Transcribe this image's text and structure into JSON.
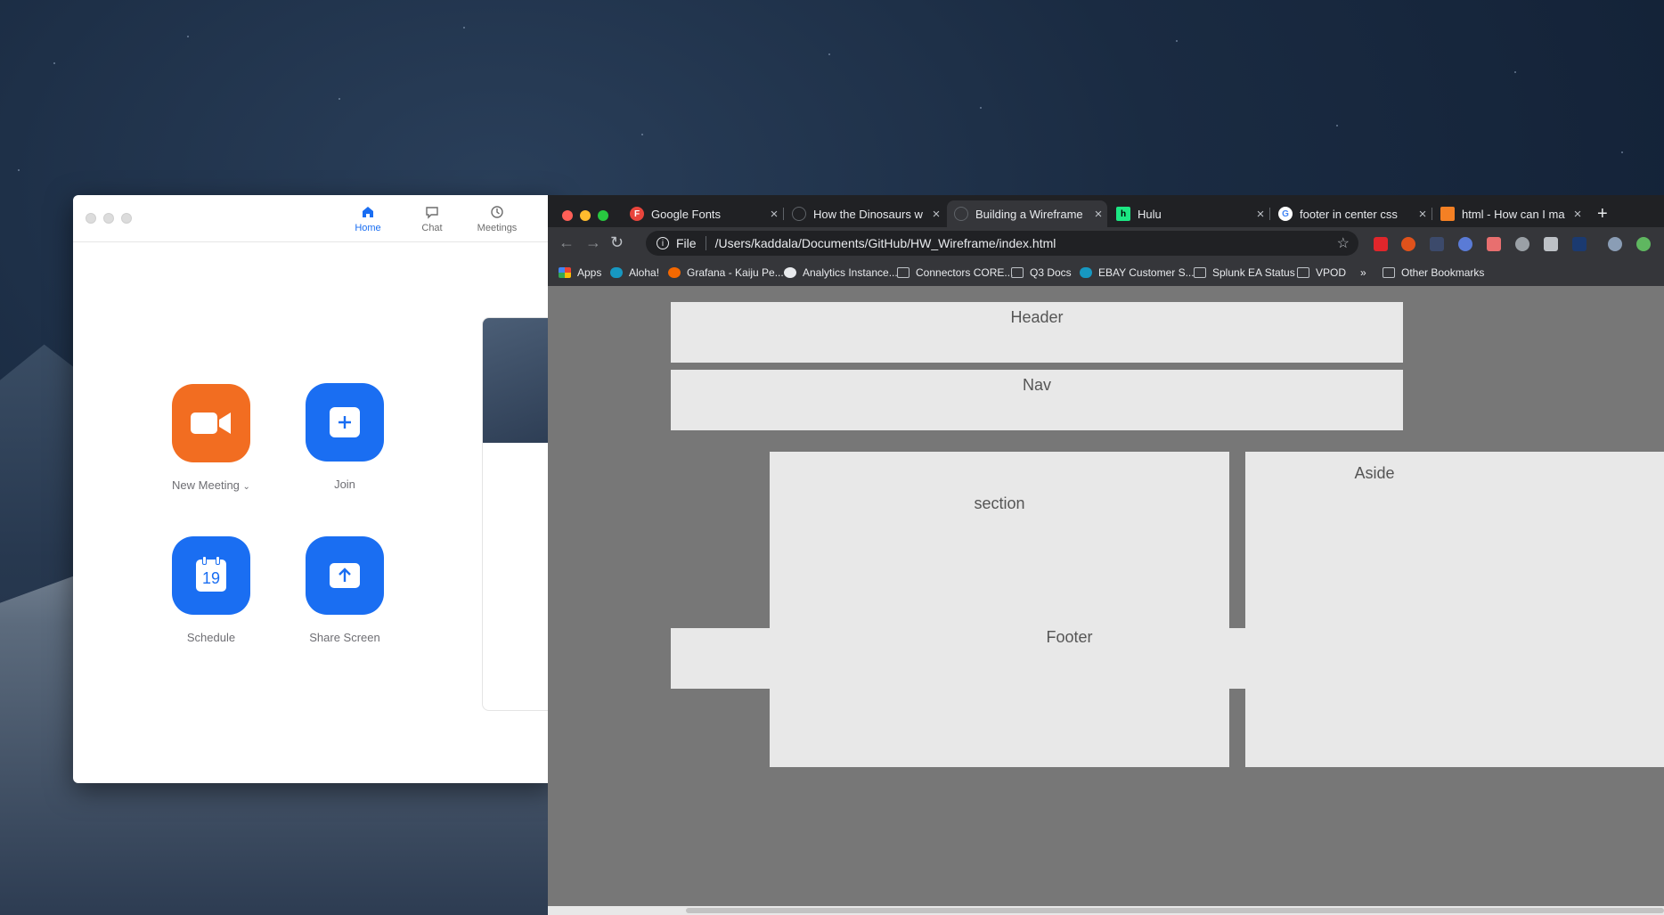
{
  "zoom": {
    "tabs": [
      {
        "label": "Home",
        "icon": "home-icon",
        "active": true
      },
      {
        "label": "Chat",
        "icon": "chat-icon"
      },
      {
        "label": "Meetings",
        "icon": "clock-icon"
      }
    ],
    "actions": [
      {
        "label": "New Meeting",
        "icon": "video-camera-icon",
        "color": "#f26d21"
      },
      {
        "label": "Join",
        "icon": "plus-icon",
        "color": "#1a6ef2"
      },
      {
        "label": "Schedule",
        "icon": "calendar-icon",
        "color": "#1a6ef2",
        "calendar_day": "19"
      },
      {
        "label": "Share Screen",
        "icon": "share-screen-icon",
        "color": "#1a6ef2"
      }
    ]
  },
  "chrome": {
    "tabs": [
      {
        "title": "Google Fonts",
        "favicon": "F",
        "favicon_color": "#e8453c"
      },
      {
        "title": "How the Dinosaurs w",
        "favicon": "",
        "favicon_color": "#5f6368"
      },
      {
        "title": "Building a Wireframe",
        "favicon": "",
        "favicon_color": "#5f6368",
        "active": true
      },
      {
        "title": "Hulu",
        "favicon": "h",
        "favicon_color": "#1ce783"
      },
      {
        "title": "footer in center css",
        "favicon": "G",
        "favicon_color": "#ffffff"
      },
      {
        "title": "html - How can I ma",
        "favicon": "",
        "favicon_color": "#f48024"
      }
    ],
    "address": {
      "scheme_label": "File",
      "url": "/Users/kaddala/Documents/GitHub/HW_Wireframe/index.html"
    },
    "bookmarks": [
      {
        "label": "Apps",
        "icon": "apps-grid-icon"
      },
      {
        "label": "Aloha!",
        "icon": "salesforce-cloud-icon"
      },
      {
        "label": "Grafana - Kaiju Pe...",
        "icon": "grafana-icon"
      },
      {
        "label": "Analytics Instance...",
        "icon": "globe-icon"
      },
      {
        "label": "Connectors CORE...",
        "icon": "folder-icon"
      },
      {
        "label": "Q3 Docs",
        "icon": "folder-icon"
      },
      {
        "label": "EBAY Customer S...",
        "icon": "salesforce-cloud-icon"
      },
      {
        "label": "Splunk EA Status",
        "icon": "folder-icon"
      },
      {
        "label": "VPOD",
        "icon": "folder-icon"
      }
    ],
    "overflow": "»",
    "other_bookmarks": "Other Bookmarks"
  },
  "wireframe": {
    "header": "Header",
    "nav": "Nav",
    "section": "section",
    "aside": "Aside",
    "footer": "Footer"
  }
}
